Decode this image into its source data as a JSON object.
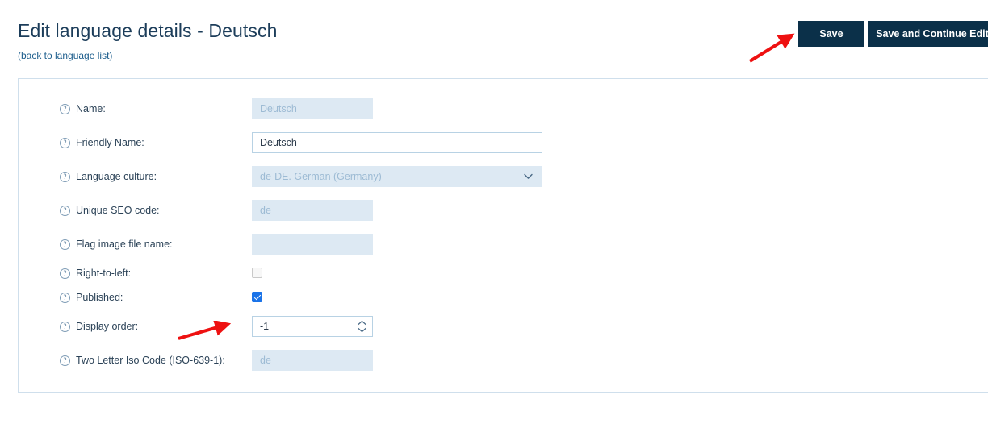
{
  "header": {
    "title": "Edit language details - Deutsch",
    "back_link": "(back to language list)",
    "save_label": "Save",
    "save_continue_label": "Save and Continue Edit"
  },
  "colors": {
    "button_bg": "#0b3049",
    "title": "#1c3d5a",
    "disabled_field_bg": "#dde9f3",
    "disabled_field_text": "#9dbbd4",
    "panel_border": "#cfdfec",
    "checkbox_checked": "#1a73e8",
    "annotation_arrow": "#ee1111"
  },
  "form": {
    "fields": [
      {
        "label": "Name:",
        "name": "name",
        "type": "text",
        "value": "Deutsch",
        "placeholder": "",
        "disabled": true,
        "width": "sm"
      },
      {
        "label": "Friendly Name:",
        "name": "friendly-name",
        "type": "text",
        "value": "Deutsch",
        "placeholder": "",
        "disabled": false,
        "width": "lg"
      },
      {
        "label": "Language culture:",
        "name": "language-culture",
        "type": "select",
        "value": "de-DE. German (Germany)",
        "disabled": true,
        "width": "lg"
      },
      {
        "label": "Unique SEO code:",
        "name": "unique-seo-code",
        "type": "text",
        "value": "de",
        "placeholder": "",
        "disabled": true,
        "width": "sm"
      },
      {
        "label": "Flag image file name:",
        "name": "flag-image-file-name",
        "type": "text",
        "value": "",
        "placeholder": "",
        "disabled": true,
        "width": "sm"
      },
      {
        "label": "Right-to-left:",
        "name": "right-to-left",
        "type": "checkbox",
        "checked": false
      },
      {
        "label": "Published:",
        "name": "published",
        "type": "checkbox",
        "checked": true
      },
      {
        "label": "Display order:",
        "name": "display-order",
        "type": "number",
        "value": "-1",
        "disabled": false,
        "width": "sm"
      },
      {
        "label": "Two Letter Iso Code (ISO-639-1):",
        "name": "two-letter-iso-code",
        "type": "text",
        "value": "de",
        "placeholder": "",
        "disabled": true,
        "width": "sm"
      }
    ],
    "help_icon_glyph": "?"
  },
  "annotations": [
    {
      "name": "arrow-to-save-button",
      "target": "save-button"
    },
    {
      "name": "arrow-to-display-order",
      "target": "display-order-input"
    }
  ]
}
